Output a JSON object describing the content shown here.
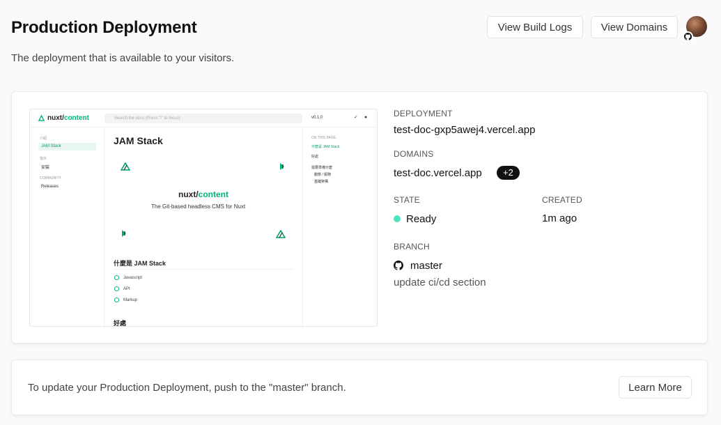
{
  "header": {
    "title": "Production Deployment",
    "subtitle": "The deployment that is available to your visitors.",
    "view_build_logs_label": "View Build Logs",
    "view_domains_label": "View Domains"
  },
  "preview": {
    "logo_prefix": "nuxt/",
    "logo_suffix": "content",
    "search_placeholder": "Search the docs (Press \"/\" to focus)",
    "version": "v0.1.0",
    "sidebar": {
      "section1": "介紹",
      "active_item": "JAM Stack",
      "section2": "指示",
      "item_install": "安裝",
      "section3": "COMMUNITY",
      "item_releases": "Releases"
    },
    "toc": {
      "heading": "ON THIS PAGE",
      "items": [
        "什麼是 JAM Stack",
        "好處",
        "需要準備什麼",
        "動態 / 服務",
        "基礎架構"
      ]
    },
    "page_title": "JAM Stack",
    "brand_prefix": "nuxt/",
    "brand_suffix": "content",
    "tagline": "The Git-based headless CMS for Nuxt",
    "section_title": "什麼是 JAM Stack",
    "list": [
      "Javascript",
      "API",
      "Markup"
    ],
    "section2_title": "好處"
  },
  "deployment": {
    "deployment_label": "DEPLOYMENT",
    "deployment_url": "test-doc-gxp5awej4.vercel.app",
    "domains_label": "DOMAINS",
    "domain": "test-doc.vercel.app",
    "domain_extra": "+2",
    "state_label": "STATE",
    "state_value": "Ready",
    "state_color": "#50e3c2",
    "created_label": "CREATED",
    "created_value": "1m ago",
    "branch_label": "BRANCH",
    "branch_name": "master",
    "commit_message": "update ci/cd section"
  },
  "footer_card": {
    "message": "To update your Production Deployment, push to the \"master\" branch.",
    "learn_more_label": "Learn More"
  },
  "icons": {
    "avatar": "user-avatar",
    "github": "github-icon",
    "status": "status-dot-icon",
    "check": "check-circle-icon"
  }
}
